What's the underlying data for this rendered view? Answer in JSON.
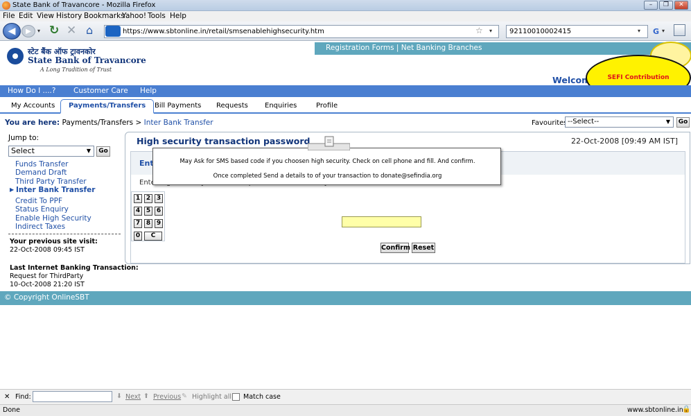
{
  "window": {
    "title": "State Bank of Travancore - Mozilla Firefox"
  },
  "menu": [
    "File",
    "Edit",
    "View",
    "History",
    "Bookmarks",
    "Yahoo!",
    "Tools",
    "Help"
  ],
  "browser": {
    "url": "https://www.sbtonline.in/retail/smsenablehighsecurity.htm",
    "search_value": "92110010002415",
    "search_engine_icon": "G"
  },
  "brand": {
    "hindi": "स्टेट बैंक ऑफ ट्रावनकोर",
    "name": "State Bank of Travancore",
    "tagline": "A Long Tradition of Trust"
  },
  "top_links": "Registration Forms | Net Banking Branches",
  "welcome": "Welcom",
  "callout": "SEFI Contribution",
  "blue_nav": [
    "How Do I ....?",
    "Customer Care",
    "Help"
  ],
  "tabs": [
    "My Accounts",
    "Payments/Transfers",
    "Bill Payments",
    "Requests",
    "Enquiries",
    "Profile"
  ],
  "breadcrumb": {
    "label": "You are here:",
    "path": "Payments/Transfers >",
    "current": "Inter Bank Transfer"
  },
  "favourites": {
    "label": "Favourites",
    "selected": "--Select--",
    "go": "Go"
  },
  "sidebar": {
    "jump_label": "Jump to:",
    "jump_selected": "Select",
    "go": "Go",
    "links": [
      "Funds Transfer",
      "Demand Draft",
      "Third Party Transfer",
      "Inter Bank Transfer",
      "Credit To PPF",
      "Status Enquiry",
      "Enable High Security",
      "Indirect Taxes"
    ],
    "prev_visit_label": "Your previous site visit:",
    "prev_visit_value": "22-Oct-2008 09:45 IST",
    "last_txn_label": "Last Internet Banking Transaction:",
    "last_txn_line1": "Request for ThirdParty",
    "last_txn_line2": "10-Oct-2008 21:20 IST"
  },
  "main": {
    "title": "High security transaction password",
    "date": "22-Oct-2008 [09:49 AM IST]",
    "inner_head": "Ente",
    "enter_line": "Enter high security transaction password received in your mobile Phone",
    "keypad": [
      "1",
      "2",
      "3",
      "4",
      "5",
      "6",
      "7",
      "8",
      "9",
      "0",
      "C"
    ],
    "confirm": "Confirm",
    "reset": "Reset"
  },
  "popup": {
    "line1": "May Ask for SMS based code if you choosen high security. Check on cell phone and fill. And confirm.",
    "line2": "Once completed Send a details to of your transaction to donate@sefindia.org"
  },
  "copyright": "© Copyright OnlineSBT",
  "findbar": {
    "label": "Find:",
    "next": "Next",
    "previous": "Previous",
    "highlight": "Highlight all",
    "match": "Match case"
  },
  "statusbar": {
    "left": "Done",
    "right": "www.sbtonline.in"
  },
  "colors": {
    "blue_nav": "#4a7fd1",
    "teal": "#5fa7bd",
    "callout": "#fff200",
    "callout_text": "#e0121a"
  }
}
